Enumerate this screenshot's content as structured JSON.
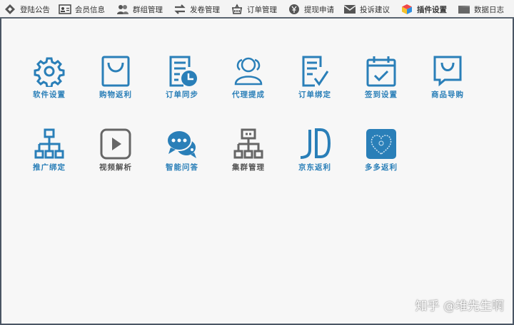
{
  "toolbar": {
    "items": [
      {
        "label": "登陆公告",
        "icon": "diamond-icon"
      },
      {
        "label": "会员信息",
        "icon": "id-card-icon"
      },
      {
        "label": "群组管理",
        "icon": "users-icon"
      },
      {
        "label": "发卷管理",
        "icon": "exchange-icon"
      },
      {
        "label": "订单管理",
        "icon": "basket-icon"
      },
      {
        "label": "提现申请",
        "icon": "yen-coin-icon"
      },
      {
        "label": "投诉建议",
        "icon": "mail-icon"
      },
      {
        "label": "插件设置",
        "icon": "cube-icon"
      },
      {
        "label": "数据日志",
        "icon": "folder-icon"
      }
    ]
  },
  "apps": [
    {
      "label": "软件设置",
      "icon": "gear-icon"
    },
    {
      "label": "购物返利",
      "icon": "shopping-bag-icon"
    },
    {
      "label": "订单同步",
      "icon": "order-clock-icon"
    },
    {
      "label": "代理提成",
      "icon": "agents-icon"
    },
    {
      "label": "订单绑定",
      "icon": "doc-check-icon"
    },
    {
      "label": "签到设置",
      "icon": "calendar-check-icon"
    },
    {
      "label": "商品导购",
      "icon": "chat-bag-icon"
    },
    {
      "label": "推广绑定",
      "icon": "hierarchy-icon"
    },
    {
      "label": "视频解析",
      "icon": "play-icon"
    },
    {
      "label": "智能问答",
      "icon": "chat-bubbles-icon"
    },
    {
      "label": "集群管理",
      "icon": "cluster-icon"
    },
    {
      "label": "京东返利",
      "icon": "jd-logo-icon"
    },
    {
      "label": "多多返利",
      "icon": "pdd-logo-icon"
    }
  ],
  "watermark": "知乎 @堆先生啊",
  "colors": {
    "accent": "#2a7fb8",
    "gray": "#666666"
  }
}
